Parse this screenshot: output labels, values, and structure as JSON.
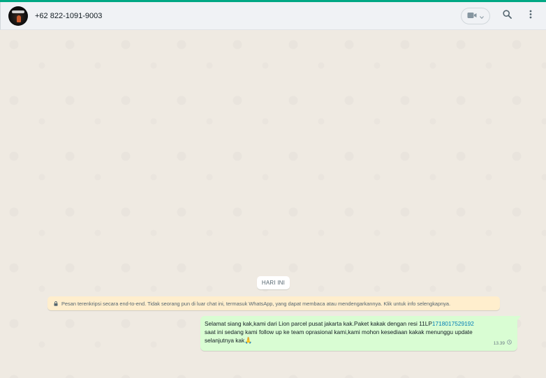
{
  "header": {
    "contact_name": "+62 822-1091-9003",
    "icons": {
      "video": "video-camera-icon",
      "dropdown": "chevron-down-icon",
      "search": "search-icon",
      "menu": "menu-dots-icon"
    }
  },
  "chat": {
    "date_chip": "HARI INI",
    "encryption_notice": "Pesan terenkripsi secara end-to-end. Tidak seorang pun di luar chat ini, termasuk WhatsApp, yang dapat membaca atau mendengarkannya. Klik untuk info selengkapnya.",
    "message": {
      "line1_prefix": "Selamat siang kak,kami dari Lion parcel pusat jakarta kak.Paket kakak dengan resi 11LP",
      "line1_link": "1718017529192",
      "line2": "saat ini sedang kami follow up ke team oprasional kami,kami mohon kesediaan kakak menunggu update",
      "line3": "selanjutnya kak",
      "emoji": "🙏",
      "time": "13.39"
    }
  },
  "colors": {
    "accent": "#00a884",
    "header_bg": "#f0f2f5",
    "chat_bg": "#efeae2",
    "outgoing_bubble": "#d9fdd3",
    "encryption_bg": "#ffeecd",
    "link": "#027eb5"
  }
}
